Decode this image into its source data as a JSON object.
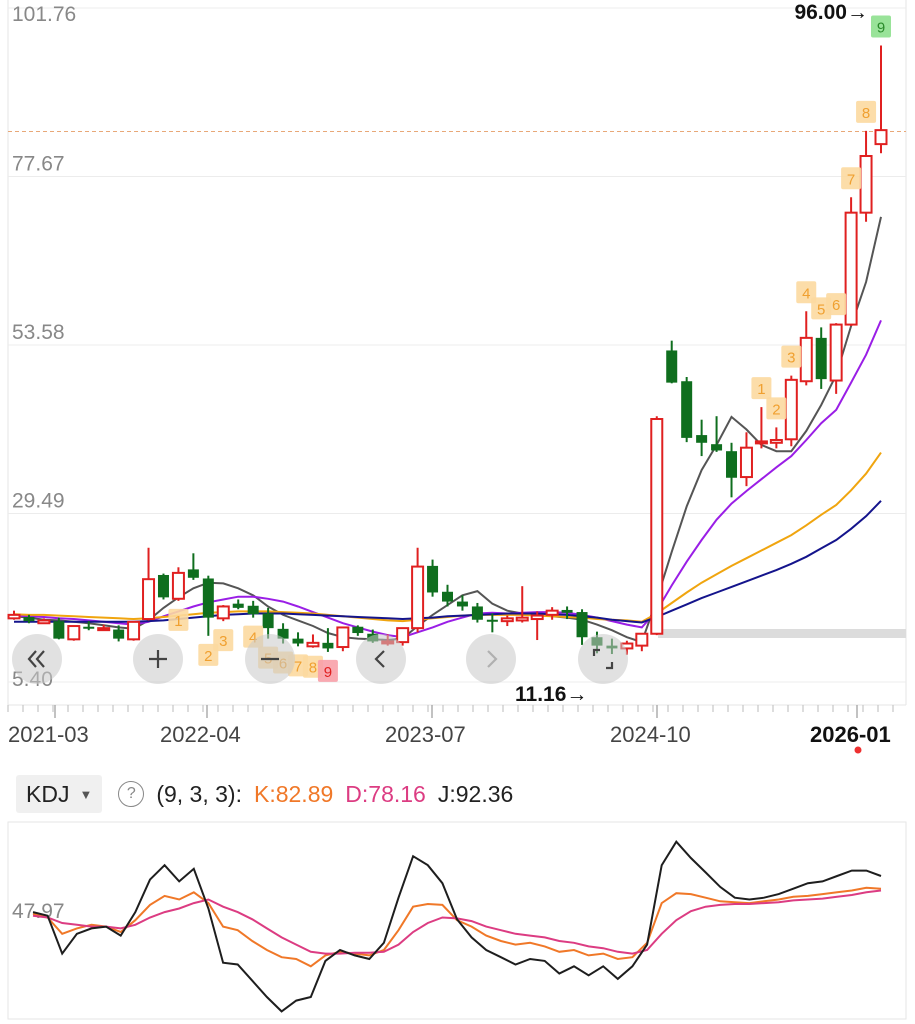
{
  "chart_data": [
    {
      "type": "candlestick",
      "title": "",
      "y_ticks": [
        "101.76",
        "77.67",
        "53.58",
        "29.49",
        "5.40"
      ],
      "x_ticks": [
        "2021-03",
        "2022-04",
        "2023-07",
        "2024-10",
        "2026-01"
      ],
      "ylim": [
        5.4,
        101.76
      ],
      "max_label": "96.00→",
      "min_label": "11.16→",
      "current_price_line": 84.1,
      "candles": [
        [
          14.5,
          15.6,
          14.3,
          15.0
        ],
        [
          14.7,
          15.0,
          13.8,
          14.1
        ],
        [
          13.8,
          14.5,
          13.7,
          14.2
        ],
        [
          14.1,
          14.6,
          11.5,
          11.6
        ],
        [
          11.5,
          13.5,
          11.3,
          13.4
        ],
        [
          13.3,
          14.1,
          12.8,
          13.2
        ],
        [
          13.0,
          13.6,
          12.7,
          13.1
        ],
        [
          12.9,
          13.5,
          11.2,
          11.6
        ],
        [
          11.5,
          14.1,
          11.3,
          14.0
        ],
        [
          14.4,
          24.6,
          14.2,
          20.1
        ],
        [
          20.7,
          20.9,
          17.2,
          17.5
        ],
        [
          17.3,
          21.8,
          17.0,
          21.0
        ],
        [
          21.5,
          23.8,
          20.0,
          20.3
        ],
        [
          20.2,
          20.6,
          12.0,
          14.6
        ],
        [
          14.5,
          16.4,
          14.1,
          16.2
        ],
        [
          16.6,
          17.2,
          15.8,
          16.0
        ],
        [
          16.3,
          17.0,
          14.6,
          15.1
        ],
        [
          15.2,
          16.0,
          11.6,
          13.1
        ],
        [
          13.0,
          13.8,
          10.9,
          11.6
        ],
        [
          11.6,
          12.5,
          10.5,
          10.9
        ],
        [
          10.5,
          12.2,
          10.3,
          11.0
        ],
        [
          11.0,
          13.1,
          9.7,
          10.2
        ],
        [
          10.4,
          13.3,
          9.8,
          13.2
        ],
        [
          13.3,
          13.5,
          12.0,
          12.4
        ],
        [
          12.3,
          12.9,
          11.0,
          11.2
        ],
        [
          11.2,
          12.2,
          10.6,
          11.2
        ],
        [
          11.1,
          13.2,
          10.6,
          13.1
        ],
        [
          13.1,
          24.6,
          12.5,
          21.9
        ],
        [
          22.0,
          22.9,
          17.6,
          18.2
        ],
        [
          18.3,
          19.3,
          16.2,
          16.9
        ],
        [
          16.9,
          17.8,
          15.6,
          16.2
        ],
        [
          16.2,
          16.7,
          13.9,
          14.3
        ],
        [
          14.3,
          15.2,
          12.5,
          14.2
        ],
        [
          14.1,
          14.9,
          13.4,
          14.5
        ],
        [
          14.2,
          19.1,
          13.9,
          14.6
        ],
        [
          14.4,
          15.5,
          11.4,
          14.9
        ],
        [
          15.0,
          16.1,
          14.3,
          15.6
        ],
        [
          15.7,
          16.2,
          14.4,
          15.3
        ],
        [
          15.4,
          15.8,
          10.7,
          11.8
        ],
        [
          11.8,
          12.6,
          9.5,
          10.6
        ],
        [
          10.6,
          11.6,
          9.4,
          10.2
        ],
        [
          10.2,
          11.3,
          9.3,
          10.9
        ],
        [
          10.6,
          12.4,
          9.8,
          12.3
        ],
        [
          12.3,
          43.4,
          12.1,
          43.0
        ],
        [
          52.8,
          54.2,
          48.1,
          48.2
        ],
        [
          48.4,
          49.0,
          39.7,
          40.3
        ],
        [
          40.7,
          42.9,
          37.7,
          39.6
        ],
        [
          39.4,
          43.4,
          38.3,
          38.5
        ],
        [
          38.4,
          39.6,
          31.8,
          34.6
        ],
        [
          34.7,
          41.1,
          33.4,
          38.9
        ],
        [
          39.7,
          44.7,
          38.8,
          39.8
        ],
        [
          39.6,
          41.8,
          38.8,
          40.0
        ],
        [
          40.1,
          49.2,
          39.1,
          48.6
        ],
        [
          48.4,
          58.4,
          47.8,
          54.6
        ],
        [
          54.6,
          56.1,
          47.3,
          48.7
        ],
        [
          48.5,
          56.7,
          46.6,
          56.5
        ],
        [
          56.5,
          74.7,
          56.3,
          72.5
        ],
        [
          72.5,
          84.2,
          71.2,
          80.6
        ],
        [
          82.3,
          96.4,
          81.0,
          84.3
        ]
      ],
      "series": [
        {
          "name": "MA5",
          "color": "#555555",
          "values": [
            14.8,
            14.6,
            14.3,
            14.2,
            14.0,
            13.8,
            13.5,
            13.2,
            13.0,
            14.2,
            16.0,
            17.5,
            18.8,
            19.6,
            19.5,
            18.8,
            17.8,
            16.2,
            15.0,
            14.2,
            13.4,
            12.4,
            11.8,
            11.6,
            11.5,
            11.4,
            11.6,
            13.4,
            15.0,
            16.4,
            17.8,
            18.4,
            16.6,
            15.6,
            15.2,
            15.0,
            14.8,
            14.6,
            14.3,
            13.6,
            12.8,
            11.8,
            11.1,
            17.2,
            24.0,
            30.5,
            35.7,
            39.3,
            43.3,
            41.5,
            39.3,
            38.4,
            38.4,
            41.3,
            45.0,
            49.3,
            56.3,
            62.6,
            71.9
          ]
        },
        {
          "name": "MA10",
          "color": "#9a1ee6",
          "values": [
            14.9,
            14.8,
            14.7,
            14.5,
            14.4,
            14.2,
            14.0,
            13.8,
            13.6,
            14.0,
            14.8,
            15.5,
            16.2,
            16.8,
            17.2,
            17.6,
            17.6,
            17.3,
            16.9,
            16.2,
            15.4,
            14.6,
            13.8,
            13.2,
            12.6,
            12.1,
            11.8,
            12.5,
            13.2,
            14.0,
            14.6,
            15.2,
            15.3,
            15.2,
            15.3,
            15.4,
            15.4,
            15.3,
            15.0,
            14.6,
            14.1,
            13.6,
            13.2,
            15.6,
            19.2,
            22.6,
            25.7,
            28.6,
            30.9,
            32.7,
            34.4,
            36.1,
            37.7,
            40.0,
            42.4,
            44.3,
            48.2,
            52.2,
            57.1
          ]
        },
        {
          "name": "MA20",
          "color": "#f0a50f",
          "values": [
            15.1,
            15.0,
            15.0,
            14.9,
            14.8,
            14.7,
            14.6,
            14.5,
            14.4,
            14.5,
            14.7,
            14.9,
            15.1,
            15.3,
            15.4,
            15.5,
            15.5,
            15.5,
            15.4,
            15.3,
            15.2,
            15.0,
            14.8,
            14.6,
            14.4,
            14.2,
            14.1,
            14.3,
            14.5,
            14.7,
            14.9,
            15.0,
            15.0,
            15.0,
            15.0,
            14.9,
            14.8,
            14.7,
            14.6,
            14.4,
            14.3,
            14.2,
            14.0,
            15.2,
            16.7,
            18.2,
            19.6,
            20.8,
            22.0,
            23.1,
            24.2,
            25.3,
            26.4,
            27.8,
            29.3,
            30.7,
            32.8,
            35.2,
            38.2
          ]
        },
        {
          "name": "MA30",
          "color": "#14148c",
          "values": [
            14.0,
            14.0,
            14.0,
            14.0,
            14.0,
            14.0,
            14.0,
            14.0,
            14.0,
            14.1,
            14.2,
            14.4,
            14.6,
            14.8,
            15.0,
            15.1,
            15.2,
            15.2,
            15.2,
            15.1,
            15.0,
            14.9,
            14.8,
            14.7,
            14.6,
            14.5,
            14.4,
            14.5,
            14.6,
            14.8,
            14.9,
            15.0,
            15.1,
            15.2,
            15.2,
            15.2,
            15.1,
            15.0,
            14.8,
            14.6,
            14.3,
            14.1,
            13.9,
            14.7,
            15.6,
            16.5,
            17.4,
            18.2,
            19.0,
            19.8,
            20.6,
            21.4,
            22.3,
            23.3,
            24.5,
            25.7,
            27.3,
            29.1,
            31.3
          ]
        }
      ],
      "signals": [
        {
          "i": 11,
          "n": "1"
        },
        {
          "i": 13,
          "n": "2"
        },
        {
          "i": 14,
          "n": "3"
        },
        {
          "i": 16,
          "n": "4"
        },
        {
          "i": 17,
          "n": "5"
        },
        {
          "i": 18,
          "n": "6"
        },
        {
          "i": 19,
          "n": "7"
        },
        {
          "i": 20,
          "n": "8"
        },
        {
          "i": 21,
          "n": "9"
        },
        {
          "i": 50,
          "n": "1"
        },
        {
          "i": 51,
          "n": "2"
        },
        {
          "i": 52,
          "n": "3"
        },
        {
          "i": 53,
          "n": "4"
        },
        {
          "i": 54,
          "n": "5"
        },
        {
          "i": 55,
          "n": "6"
        },
        {
          "i": 56,
          "n": "7"
        },
        {
          "i": 57,
          "n": "8"
        },
        {
          "i": 58,
          "n": "9"
        }
      ]
    },
    {
      "type": "line",
      "title": "",
      "y_ticks": [
        "47.97"
      ],
      "series": [
        {
          "name": "K",
          "color": "#f07828",
          "values": [
            62,
            58,
            40,
            46,
            50,
            48,
            42,
            55,
            72,
            82,
            78,
            86,
            74,
            48,
            44,
            32,
            22,
            14,
            12,
            4,
            16,
            20,
            18,
            16,
            22,
            44,
            70,
            73,
            72,
            55,
            48,
            38,
            32,
            28,
            30,
            26,
            20,
            22,
            16,
            18,
            12,
            14,
            30,
            74,
            85,
            84,
            80,
            76,
            75,
            74,
            76,
            78,
            81,
            82,
            84,
            86,
            88,
            91,
            90
          ]
        },
        {
          "name": "D",
          "color": "#dc3c82",
          "values": [
            60,
            58,
            52,
            50,
            48,
            48,
            46,
            50,
            58,
            64,
            68,
            74,
            78,
            70,
            64,
            56,
            46,
            36,
            28,
            20,
            18,
            18,
            19,
            19,
            20,
            28,
            42,
            52,
            58,
            57,
            54,
            48,
            44,
            40,
            38,
            36,
            32,
            30,
            26,
            24,
            20,
            18,
            22,
            40,
            55,
            65,
            70,
            72,
            73,
            73,
            74,
            75,
            77,
            78,
            79,
            81,
            83,
            86,
            88
          ]
        },
        {
          "name": "J",
          "color": "#1e1e1e",
          "values": [
            64,
            60,
            18,
            40,
            46,
            48,
            38,
            64,
            100,
            116,
            98,
            112,
            68,
            8,
            6,
            -12,
            -30,
            -46,
            -34,
            -30,
            10,
            22,
            16,
            12,
            30,
            80,
            126,
            116,
            96,
            56,
            36,
            22,
            14,
            6,
            12,
            10,
            -4,
            4,
            -6,
            4,
            -10,
            4,
            28,
            116,
            142,
            124,
            108,
            92,
            80,
            78,
            80,
            84,
            90,
            96,
            98,
            104,
            110,
            110,
            104
          ]
        }
      ],
      "ylim": [
        -50,
        155
      ]
    }
  ],
  "indicator": {
    "name": "KDJ",
    "params": "(9, 3, 3):",
    "k_text": "K:82.89",
    "d_text": "D:78.16",
    "j_text": "J:92.36",
    "help_icon": "question-circle-icon"
  },
  "controls": [
    {
      "icon": "double-chevron-left-icon"
    },
    {
      "icon": "plus-icon"
    },
    {
      "icon": "minus-icon"
    },
    {
      "icon": "chevron-left-icon"
    },
    {
      "icon": "chevron-right-icon"
    },
    {
      "icon": "fullscreen-corners-icon"
    }
  ],
  "colors": {
    "up": "#e02020",
    "down": "#0f6e1e",
    "signal_box": "#fcd9a0",
    "signal_text": "#f0a030",
    "signal_last": "#8ee08e"
  }
}
